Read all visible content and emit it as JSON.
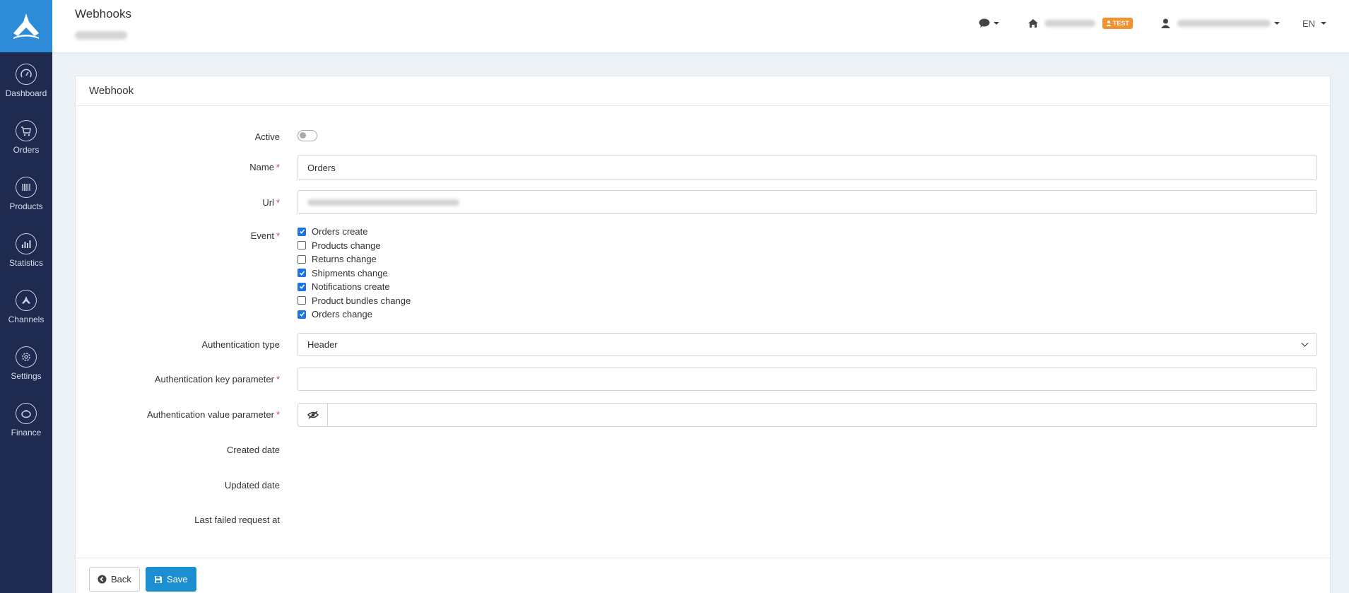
{
  "sidebar": {
    "items": [
      {
        "label": "Dashboard",
        "icon": "speedometer-icon"
      },
      {
        "label": "Orders",
        "icon": "cart-icon"
      },
      {
        "label": "Products",
        "icon": "barcode-icon"
      },
      {
        "label": "Statistics",
        "icon": "chart-icon"
      },
      {
        "label": "Channels",
        "icon": "channels-icon"
      },
      {
        "label": "Settings",
        "icon": "gear-icon"
      },
      {
        "label": "Finance",
        "icon": "piggy-bank-icon"
      }
    ]
  },
  "header": {
    "title": "Webhooks",
    "badge": "TEST",
    "language": "EN"
  },
  "card": {
    "title": "Webhook"
  },
  "form": {
    "active_label": "Active",
    "name_label": "Name",
    "name_value": "Orders",
    "url_label": "Url",
    "event_label": "Event",
    "events": [
      {
        "label": "Orders create",
        "checked": true
      },
      {
        "label": "Products change",
        "checked": false
      },
      {
        "label": "Returns change",
        "checked": false
      },
      {
        "label": "Shipments change",
        "checked": true
      },
      {
        "label": "Notifications create",
        "checked": true
      },
      {
        "label": "Product bundles change",
        "checked": false
      },
      {
        "label": "Orders change",
        "checked": true
      }
    ],
    "auth_type_label": "Authentication type",
    "auth_type_value": "Header",
    "auth_key_label": "Authentication key parameter",
    "auth_value_label": "Authentication value parameter",
    "created_label": "Created date",
    "updated_label": "Updated date",
    "failed_label": "Last failed request at",
    "required_mark": "*"
  },
  "footer": {
    "back_label": "Back",
    "save_label": "Save"
  },
  "colors": {
    "sidebar_bg": "#1e2a4f",
    "logo_bg": "#2d8bd8",
    "badge": "#f0922d",
    "primary": "#1b8fd2",
    "required": "#d9394a"
  }
}
